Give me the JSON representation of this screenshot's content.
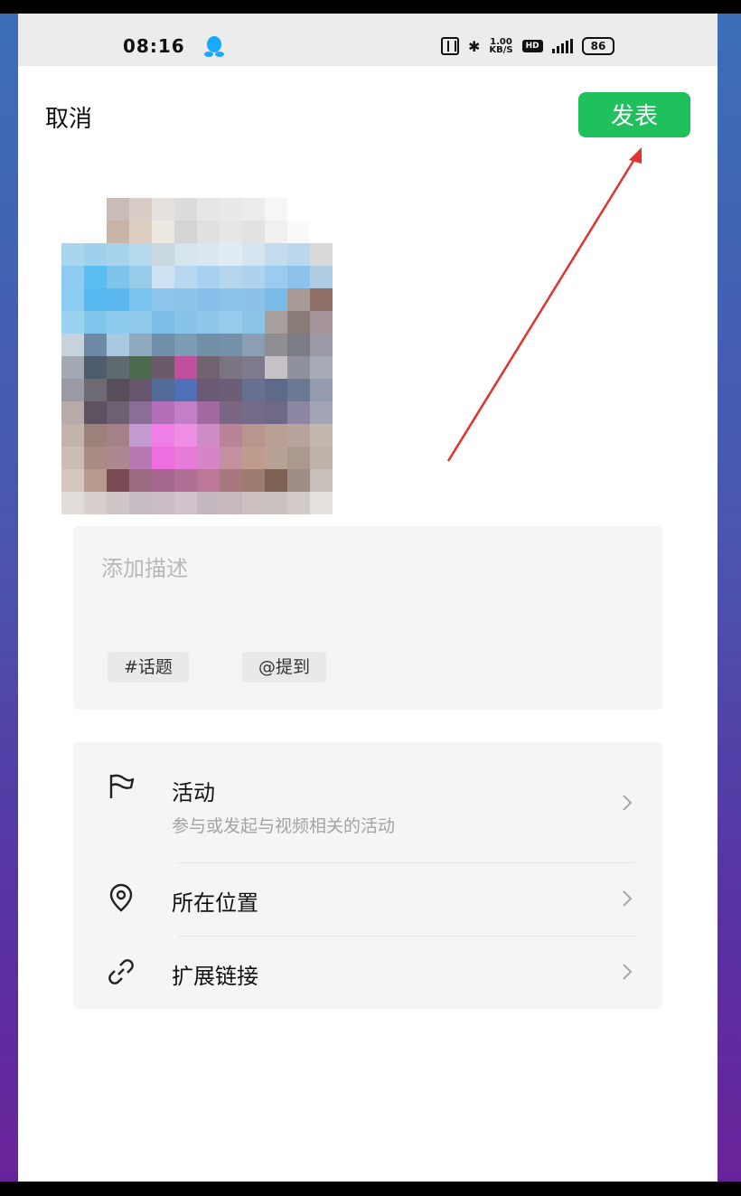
{
  "status_bar": {
    "time": "08:16",
    "speed": "1.00\nKB/S",
    "hd": "HD",
    "network": "4G",
    "battery": "86"
  },
  "header": {
    "cancel_label": "取消",
    "publish_label": "发表"
  },
  "colors": {
    "publish_bg": "#20c05c",
    "annotation_arrow": "#e0322e"
  },
  "description": {
    "placeholder": "添加描述",
    "tags": [
      "#话题",
      "@提到"
    ]
  },
  "options": [
    {
      "icon": "flag-icon",
      "title": "活动",
      "subtitle": "参与或发起与视频相关的活动"
    },
    {
      "icon": "location-pin-icon",
      "title": "所在位置"
    },
    {
      "icon": "link-icon",
      "title": "扩展链接"
    }
  ]
}
